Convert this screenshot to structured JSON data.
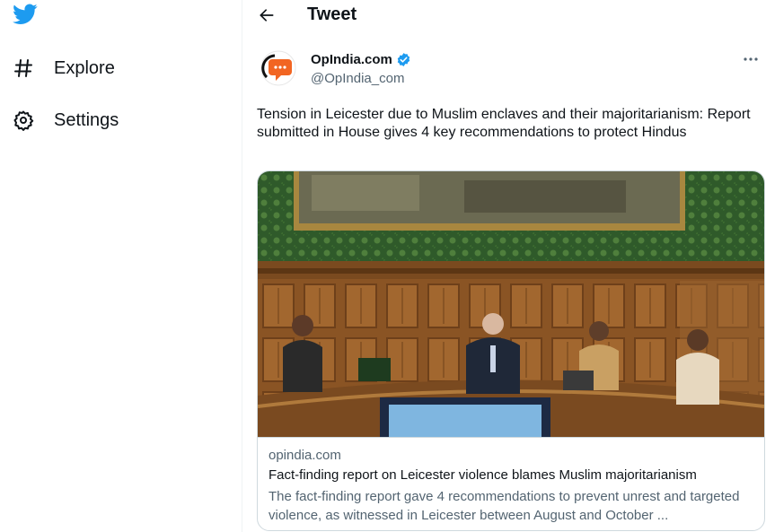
{
  "sidebar": {
    "logo_icon": "twitter-bird-icon",
    "items": [
      {
        "label": "Explore",
        "icon": "hashtag-icon"
      },
      {
        "label": "Settings",
        "icon": "gear-icon"
      }
    ]
  },
  "header": {
    "back_icon": "arrow-left-icon",
    "title": "Tweet"
  },
  "tweet": {
    "author_name": "OpIndia.com",
    "author_handle": "@OpIndia_com",
    "verified": true,
    "more_icon": "more-horizontal-icon",
    "text": "Tension in Leicester due to Muslim enclaves and their majoritarianism: Report submitted in House gives 4 key recommendations to protect Hindus",
    "card": {
      "domain": "opindia.com",
      "title": "Fact-finding report on Leicester violence blames Muslim majoritarianism",
      "description": "The fact-finding report gave 4 recommendations to prevent unrest and targeted violence, as witnessed in Leicester between August and October ...",
      "image_alt": "Meeting room with wood panelling and green wallpaper"
    }
  },
  "colors": {
    "brand": "#1d9bf0",
    "text": "#0f1419",
    "secondary": "#536471",
    "border": "#cfd9de",
    "avatar_accent": "#f26522"
  }
}
